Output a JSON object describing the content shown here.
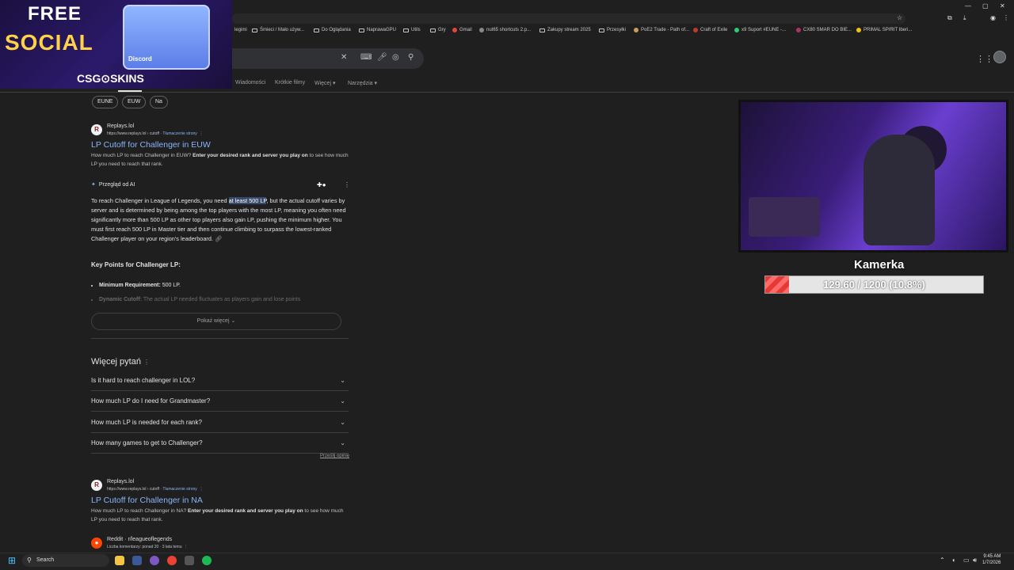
{
  "bookmarks": [
    "Śmieci / Mało używ...",
    "Do Oglądania",
    "NaprawaGPU",
    "Utils",
    "Gry",
    "Gmail",
    "nut65 shortcuts 2.p...",
    "Zakupy stream 2025",
    "Przesyłki",
    "PoE2 Trade - Path of...",
    "Craft of Exile",
    "x9 Suport #EUNE -...",
    "CX80 SMAR DO BIE...",
    "PRIMAL SPIRIT Iberi..."
  ],
  "bookmark_partial": "legimi",
  "nav_tabs": [
    "Wiadomości",
    "Krótkie filmy",
    "Więcej",
    "Narzędzia"
  ],
  "chips": [
    "EUNE",
    "EUW",
    "Na"
  ],
  "result1": {
    "site": "Replays.lol",
    "url": "https://www.replays.lol › cutoff",
    "translate": "Tłumaczenie strony",
    "title": "LP Cutoff for Challenger in EUW",
    "snippet_a": "How much LP to reach Challenger in EUW? ",
    "snippet_b": "Enter your desired rank and server you play on",
    "snippet_c": " to see how much LP you need to reach that rank."
  },
  "ai": {
    "header": "Przegląd od AI",
    "p1": "To reach Challenger in League of Legends, you need ",
    "hl": "at least 500 LP",
    "p2": ", but the actual cutoff varies by server and is determined by being among the top players with the most LP, meaning you often need significantly more than 500 LP as other top players also gain LP, pushing the minimum higher. You must first reach 500 LP in Master tier and then continue climbing to surpass the lowest-ranked Challenger player on your region's leaderboard.",
    "kp_title": "Key Points for Challenger LP:",
    "kp1_b": "Minimum Requirement:",
    "kp1": " 500 LP.",
    "kp2_b": "Dynamic Cutoff:",
    "kp2": " The actual LP needed fluctuates as players gain and lose points",
    "more": "Pokaż więcej"
  },
  "paa": {
    "title": "Więcej pytań",
    "questions": [
      "Is it hard to reach challenger in LOL?",
      "How much LP do I need for Grandmaster?",
      "How much LP is needed for each rank?",
      "How many games to get to Challenger?"
    ],
    "feedback": "Prześlij opinię"
  },
  "result2": {
    "site": "Replays.lol",
    "url": "https://www.replays.lol › cutoff",
    "translate": "Tłumaczenie strony",
    "title": "LP Cutoff for Challenger in NA",
    "snippet_a": "How much LP to reach Challenger in NA? ",
    "snippet_b": "Enter your desired rank and server you play on",
    "snippet_c": " to see how much LP you need to reach that rank."
  },
  "result3": {
    "site": "Reddit · r/leagueoflegends",
    "meta": "Liczba komentarzy: ponad 20 · 3 lata temu"
  },
  "ad": {
    "line1": "FREE",
    "line2": "SOCIAL",
    "box": "Discord",
    "logo": "CSG⊙SKINS"
  },
  "overlay": {
    "cam_title": "Kamerka",
    "bar_text": "129.60 / 1200 (10.8%)",
    "progress": 0.108
  },
  "taskbar": {
    "search": "Search",
    "time": "9:45 AM",
    "date": "1/7/2026"
  },
  "colors": {
    "accent": "#8ab4f8",
    "bar_fill": "#e53935"
  }
}
